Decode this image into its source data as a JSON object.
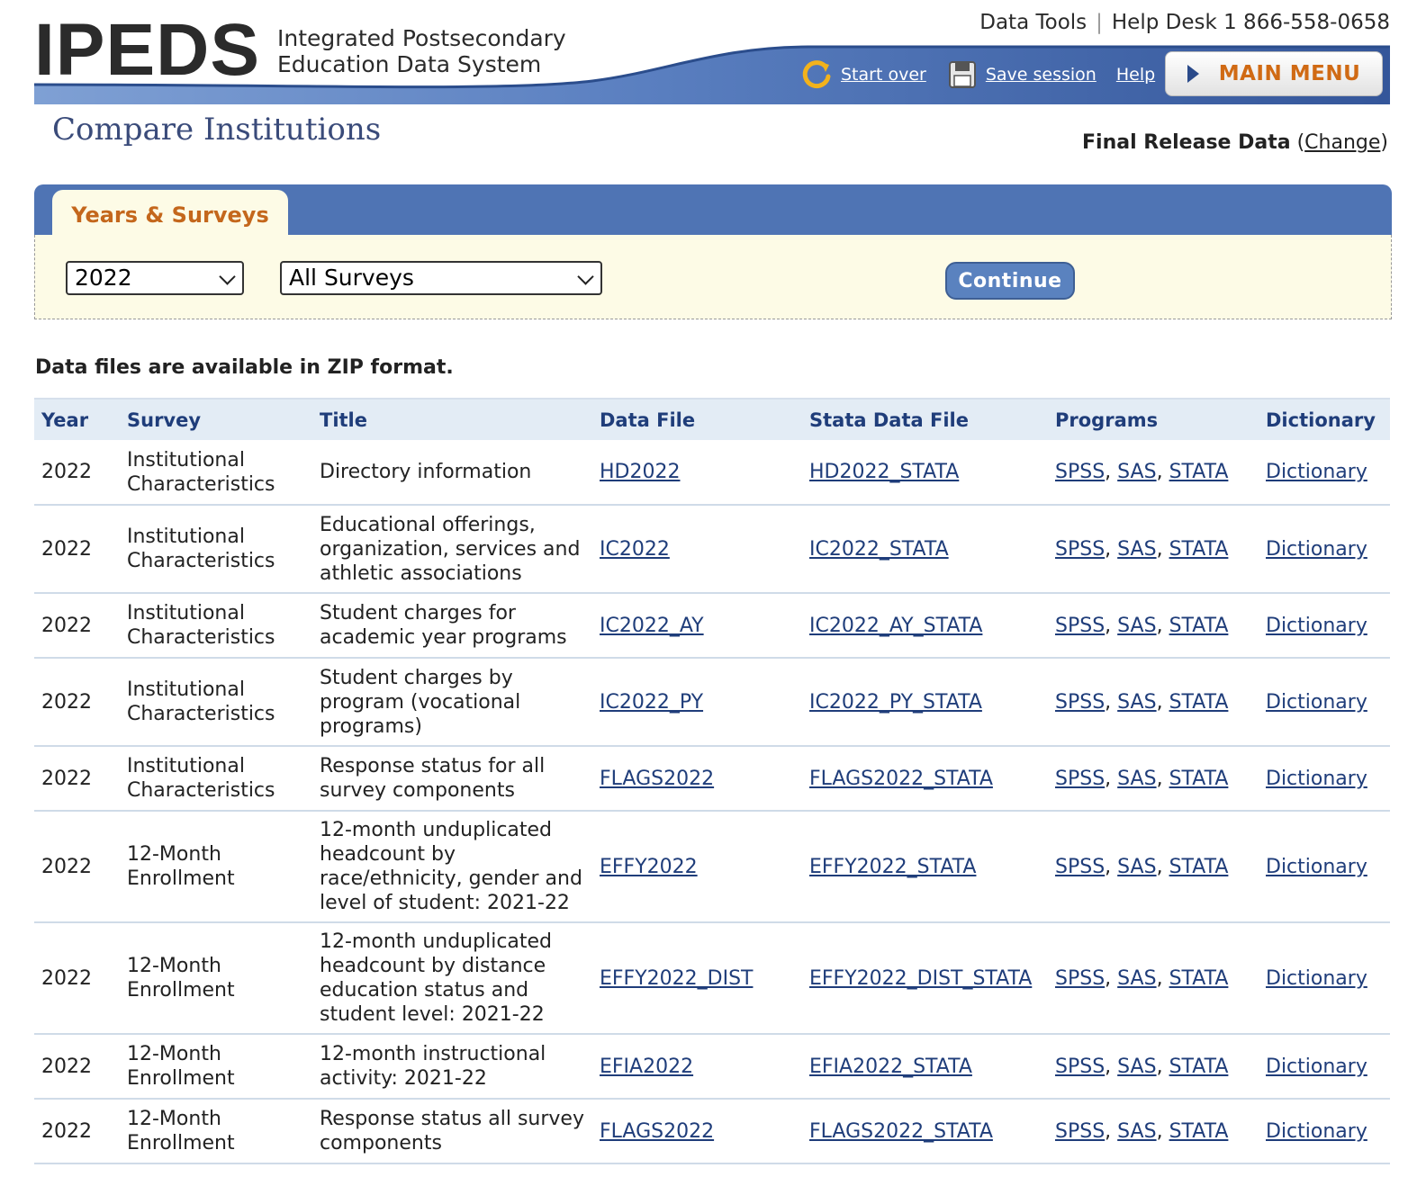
{
  "header": {
    "logo": "IPEDS",
    "subtitle_line1": "Integrated Postsecondary",
    "subtitle_line2": "Education Data System",
    "data_tools": "Data Tools",
    "help_desk": "Help Desk 1 866-558-0658",
    "start_over": "Start over",
    "save_session": "Save session",
    "help": "Help",
    "main_menu": "MAIN MENU"
  },
  "page": {
    "title": "Compare Institutions",
    "release_label": "Final Release Data",
    "change_link": "Change"
  },
  "panel": {
    "tab_label": "Years & Surveys",
    "year_selected": "2022",
    "survey_selected": "All Surveys",
    "continue_label": "Continue"
  },
  "note": "Data files are available in ZIP format.",
  "table": {
    "headers": [
      "Year",
      "Survey",
      "Title",
      "Data File",
      "Stata Data File",
      "Programs",
      "Dictionary"
    ],
    "rows": [
      {
        "year": "2022",
        "survey": "Institutional Characteristics",
        "title": "Directory information",
        "data_file": "HD2022",
        "stata_file": "HD2022_STATA",
        "spss": "SPSS",
        "sas": "SAS",
        "stata": "STATA",
        "dictionary": "Dictionary"
      },
      {
        "year": "2022",
        "survey": "Institutional Characteristics",
        "title": "Educational offerings, organization, services and athletic associations",
        "data_file": "IC2022",
        "stata_file": "IC2022_STATA",
        "spss": "SPSS",
        "sas": "SAS",
        "stata": "STATA",
        "dictionary": "Dictionary"
      },
      {
        "year": "2022",
        "survey": "Institutional Characteristics",
        "title": "Student charges for academic year programs",
        "data_file": "IC2022_AY",
        "stata_file": "IC2022_AY_STATA",
        "spss": "SPSS",
        "sas": "SAS",
        "stata": "STATA",
        "dictionary": "Dictionary"
      },
      {
        "year": "2022",
        "survey": "Institutional Characteristics",
        "title": "Student charges by program (vocational programs)",
        "data_file": "IC2022_PY",
        "stata_file": "IC2022_PY_STATA",
        "spss": "SPSS",
        "sas": "SAS",
        "stata": "STATA",
        "dictionary": "Dictionary"
      },
      {
        "year": "2022",
        "survey": "Institutional Characteristics",
        "title": "Response status for all survey components",
        "data_file": "FLAGS2022",
        "stata_file": "FLAGS2022_STATA",
        "spss": "SPSS",
        "sas": "SAS",
        "stata": "STATA",
        "dictionary": "Dictionary"
      },
      {
        "year": "2022",
        "survey": "12-Month Enrollment",
        "title": "12-month unduplicated headcount by race/ethnicity, gender and level of student: 2021-22",
        "data_file": "EFFY2022",
        "stata_file": "EFFY2022_STATA",
        "spss": "SPSS",
        "sas": "SAS",
        "stata": "STATA",
        "dictionary": "Dictionary"
      },
      {
        "year": "2022",
        "survey": "12-Month Enrollment",
        "title": "12-month unduplicated headcount by distance education status and student level: 2021-22",
        "data_file": "EFFY2022_DIST",
        "stata_file": "EFFY2022_DIST_STATA",
        "spss": "SPSS",
        "sas": "SAS",
        "stata": "STATA",
        "dictionary": "Dictionary"
      },
      {
        "year": "2022",
        "survey": "12-Month Enrollment",
        "title": "12-month instructional activity: 2021-22",
        "data_file": "EFIA2022",
        "stata_file": "EFIA2022_STATA",
        "spss": "SPSS",
        "sas": "SAS",
        "stata": "STATA",
        "dictionary": "Dictionary"
      },
      {
        "year": "2022",
        "survey": "12-Month Enrollment",
        "title": "Response status all survey components",
        "data_file": "FLAGS2022",
        "stata_file": "FLAGS2022_STATA",
        "spss": "SPSS",
        "sas": "SAS",
        "stata": "STATA",
        "dictionary": "Dictionary"
      }
    ]
  },
  "colors": {
    "banner_blue": "#4f74b4",
    "link_blue": "#1f3d7a",
    "tab_orange": "#c4671c",
    "panel_cream": "#fdfbe6",
    "header_row": "#e3ecf5"
  }
}
